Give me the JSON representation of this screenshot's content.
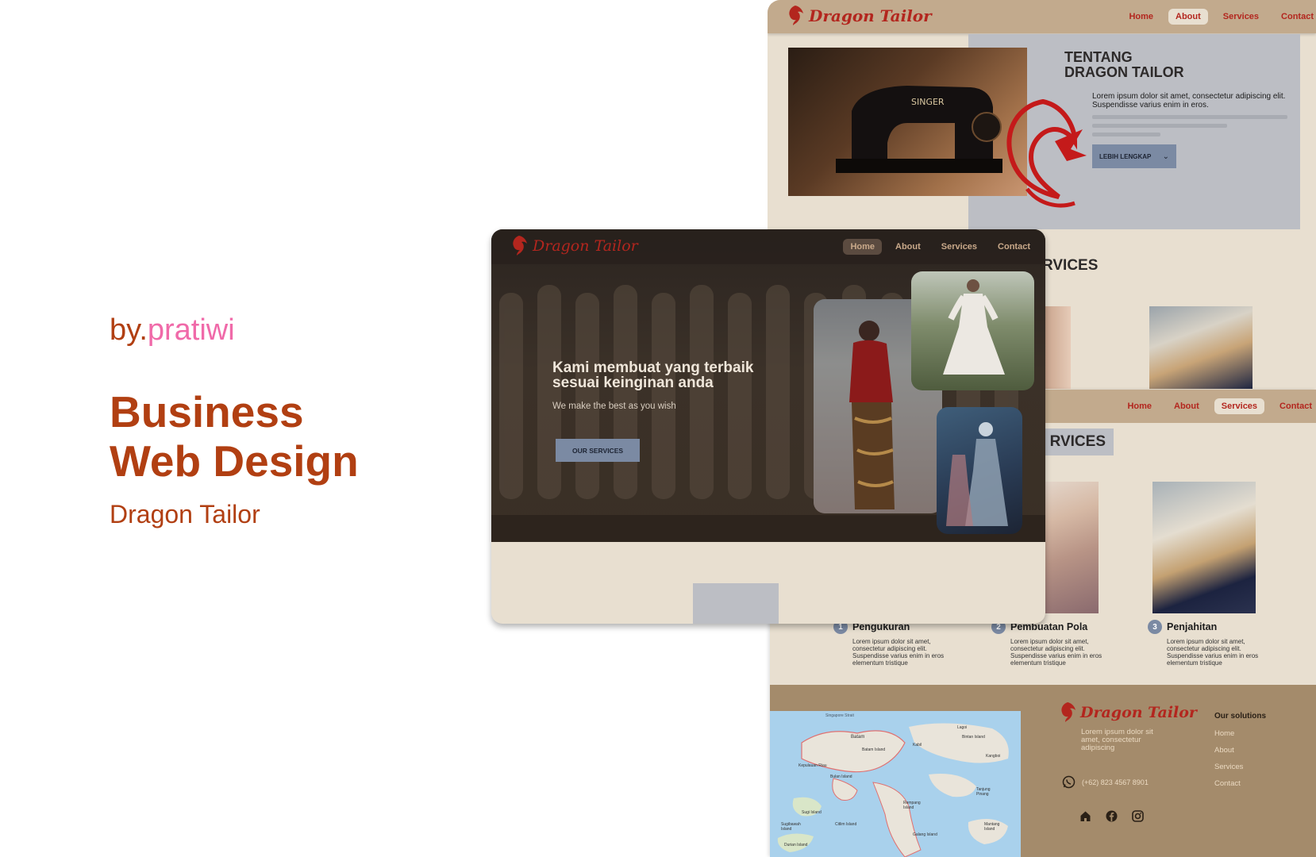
{
  "intro": {
    "by_prefix": "by.",
    "by_name": "pratiwi",
    "title_line1": "Business",
    "title_line2": "Web Design",
    "subtitle": "Dragon Tailor"
  },
  "brand": {
    "logo": "Dragon Tailor"
  },
  "about_page": {
    "nav": [
      "Home",
      "About",
      "Services",
      "Contact"
    ],
    "active_nav": "About",
    "heading_line1": "TENTANG",
    "heading_line2": "DRAGON TAILOR",
    "body": "Lorem ipsum dolor sit amet, consectetur adipiscing elit. Suspendisse varius enim in eros.",
    "button": "LEBIH LENGKAP",
    "services_fragment": "RVICES",
    "photo_label": "SINGER"
  },
  "services_page": {
    "nav": [
      "Home",
      "About",
      "Services",
      "Contact"
    ],
    "active_nav": "Services",
    "heading_fragment": "RVICES",
    "steps": [
      {
        "num": "1",
        "title": "Pengukuran",
        "desc": "Lorem ipsum dolor sit amet, consectetur adipiscing elit. Suspendisse varius enim in eros elementum tristique"
      },
      {
        "num": "2",
        "title": "Pembuatan Pola",
        "desc": "Lorem ipsum dolor sit amet, consectetur adipiscing elit. Suspendisse varius enim in eros elementum tristique"
      },
      {
        "num": "3",
        "title": "Penjahitan",
        "desc": "Lorem ipsum dolor sit amet, consectetur adipiscing elit. Suspendisse varius enim in eros elementum tristique"
      }
    ],
    "footer": {
      "logo": "Dragon Tailor",
      "tagline": "Lorem ipsum dolor sit amet, consectetur adipiscing",
      "phone": "(+62) 823 4567 8901",
      "solutions_title": "Our solutions",
      "solutions": [
        "Home",
        "About",
        "Services",
        "Contact"
      ],
      "social_icons": [
        "home-icon",
        "facebook-icon",
        "instagram-icon"
      ]
    },
    "map_labels": [
      "Singapore Strait",
      "Batam",
      "Batam Island",
      "Bintan Island",
      "Kabil",
      "Kepulauan Riau",
      "Bulan Island",
      "Sugi Island",
      "Citlim Island",
      "Rempang Island",
      "Galang Island",
      "Sugibawah Island",
      "Mantang Island",
      "Durian Island",
      "Tanjung Pinang",
      "Kangboi",
      "Lagoi"
    ]
  },
  "home_page": {
    "nav": [
      "Home",
      "About",
      "Services",
      "Contact"
    ],
    "active_nav": "Home",
    "hero_line1": "Kami membuat yang terbaik",
    "hero_line2": "sesuai keinginan anda",
    "hero_sub": "We make the best as you wish",
    "hero_button": "OUR SERVICES"
  },
  "colors": {
    "accent_pink": "#f06aa9",
    "accent_rust": "#b13f12",
    "logo_red": "#b3261e",
    "tan": "#c2aa8d",
    "beige": "#e8dfd0",
    "footer_brown": "#a48b6b",
    "button_blue": "#7b8aa3",
    "panel_gray": "#bcbec4"
  }
}
